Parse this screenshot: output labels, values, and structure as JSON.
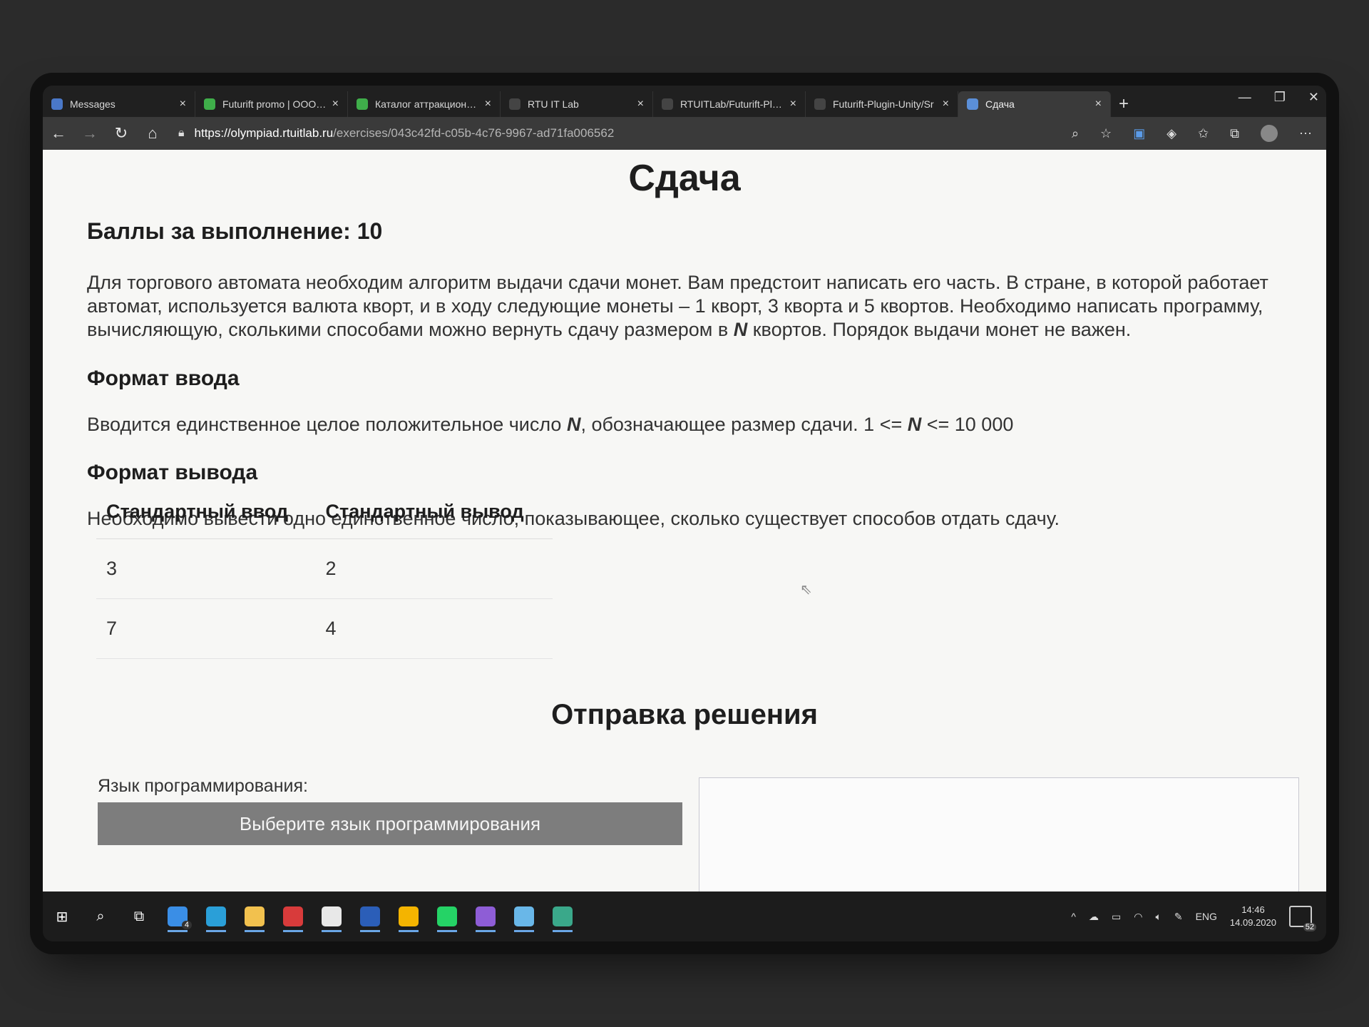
{
  "browser": {
    "tabs": [
      {
        "label": "Messages",
        "icon": "messages-icon",
        "color": "#4a78c8"
      },
      {
        "label": "Futurift promo | OOO \"Li",
        "icon": "futurift-icon",
        "color": "#3fae4a"
      },
      {
        "label": "Каталог аттракционов в",
        "icon": "futurift-icon",
        "color": "#3fae4a"
      },
      {
        "label": "RTU IT Lab",
        "icon": "github-icon",
        "color": "#444444"
      },
      {
        "label": "RTUITLab/Futurift-Plugin",
        "icon": "github-icon",
        "color": "#444444"
      },
      {
        "label": "Futurift-Plugin-Unity/Sr",
        "icon": "github-icon",
        "color": "#444444"
      },
      {
        "label": "Сдача",
        "icon": "page-icon",
        "color": "#5b8fd8"
      }
    ],
    "url_host": "https://olympiad.rtuitlab.ru",
    "url_path": "/exercises/043c42fd-c05b-4c76-9967-ad71fa006562"
  },
  "page": {
    "title": "Сдача",
    "score": "Баллы за выполнение: 10",
    "description_pre": "Для торгового автомата необходим алгоритм выдачи сдачи монет. Вам предстоит написать его часть. В стране, в которой работает автомат, используется валюта кворт, и в ходу следующие монеты – 1 кворт, 3 кворта и 5 квортов. Необходимо написать программу, вычисляющую, сколькими способами можно вернуть сдачу размером в ",
    "description_var": "N",
    "description_post": " квортов. Порядок выдачи монет не важен.",
    "input_heading": "Формат ввода",
    "input_pre": "Вводится единственное целое положительное число ",
    "input_var1": "N",
    "input_mid": ", обозначающее размер сдачи. 1 <= ",
    "input_var2": "N",
    "input_post": " <= 10 000",
    "output_heading": "Формат вывода",
    "output_text": "Необходимо вывести одно единственное число, показывающее, сколько существует способов отдать сдачу.",
    "examples": {
      "headers": [
        "Стандартный ввод",
        "Стандартный вывод"
      ],
      "rows": [
        [
          "3",
          "2"
        ],
        [
          "7",
          "4"
        ]
      ]
    },
    "submit_heading": "Отправка решения",
    "language_label": "Язык программирования:",
    "language_select": "Выберите язык программирования"
  },
  "taskbar": {
    "apps": [
      {
        "name": "explorer-badge",
        "color": "#3a8ee6",
        "badge": "4"
      },
      {
        "name": "edge",
        "color": "#2a9fd8"
      },
      {
        "name": "files",
        "color": "#f2c14e"
      },
      {
        "name": "app-red",
        "color": "#d83b3b"
      },
      {
        "name": "slack",
        "color": "#e8e8e8"
      },
      {
        "name": "word",
        "color": "#2b5eb8"
      },
      {
        "name": "chrome",
        "color": "#f4b400"
      },
      {
        "name": "whatsapp",
        "color": "#25d366"
      },
      {
        "name": "visual-studio",
        "color": "#8e5dd6"
      },
      {
        "name": "app-blue",
        "color": "#69b7e8"
      },
      {
        "name": "app-green",
        "color": "#3aa88a"
      }
    ],
    "lang": "ENG",
    "time": "14:46",
    "date": "14.09.2020",
    "notifications": "52"
  }
}
